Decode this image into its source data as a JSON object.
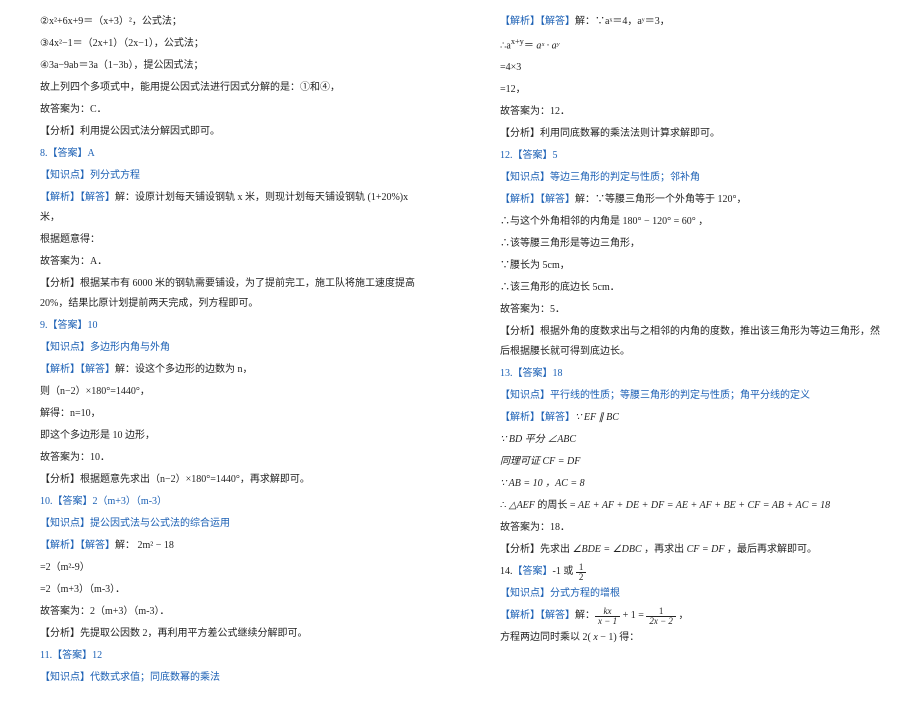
{
  "left": [
    {
      "t": "②x²+6x+9＝（x+3）²，公式法；"
    },
    {
      "t": "③4x²−1＝（2x+1）（2x−1），公式法；"
    },
    {
      "t": "④3a−9ab＝3a（1−3b），提公因式法；"
    },
    {
      "t": "故上列四个多项式中，能用提公因式法进行因式分解的是：①和④，"
    },
    {
      "t": "故答案为：C．"
    },
    {
      "t": "【分析】利用提公因式法分解因式即可。"
    },
    {
      "t": "8.【答案】A",
      "cls": "ans"
    },
    {
      "t": "【知识点】列分式方程",
      "cls": "blue"
    },
    {
      "lead": "【解析】【解答】",
      "leadCls": "blue",
      "rest": "解：设原计划每天铺设钢轨 x 米，则现计划每天铺设钢轨 (1+20%)x 米，"
    },
    {
      "t": "根据题意得："
    },
    {
      "t": "故答案为：A．"
    },
    {
      "t": "【分析】根据某市有 6000 米的钢轨需要铺设，为了提前完工，施工队将施工速度提高 20%，结果比原计划提前两天完成，列方程即可。"
    },
    {
      "t": "9.【答案】10",
      "cls": "ans"
    },
    {
      "t": "【知识点】多边形内角与外角",
      "cls": "blue"
    },
    {
      "lead": "【解析】【解答】",
      "leadCls": "blue",
      "rest": "解：设这个多边形的边数为 n，"
    },
    {
      "t": "则（n−2）×180°=1440°，"
    },
    {
      "t": "解得：n=10，"
    },
    {
      "t": "即这个多边形是 10 边形，"
    },
    {
      "t": "故答案为：10．"
    },
    {
      "t": "【分析】根据题意先求出（n−2）×180°=1440°，再求解即可。"
    },
    {
      "t": "10.【答案】2（m+3）（m-3）",
      "cls": "ans"
    },
    {
      "t": "【知识点】提公因式法与公式法的综合运用",
      "cls": "blue"
    },
    {
      "lead": "【解析】【解答】",
      "leadCls": "blue",
      "rest": "解：  2m² − 18"
    },
    {
      "t": "=2（m²-9）"
    },
    {
      "t": "=2（m+3）（m-3）．"
    },
    {
      "t": "故答案为：2（m+3）（m-3）．"
    },
    {
      "t": "【分析】先提取公因数 2，再利用平方差公式继续分解即可。"
    },
    {
      "t": "11.【答案】12",
      "cls": "ans"
    },
    {
      "t": "【知识点】代数式求值；同底数幂的乘法",
      "cls": "blue"
    }
  ],
  "right": [
    {
      "lead": "【解析】【解答】",
      "leadCls": "blue",
      "rest": "解：∵aˣ＝4，aʸ＝3，"
    },
    {
      "html": "∴a<sup>x+y</sup>＝ <span class='math'>aˣ · aʸ</span>"
    },
    {
      "t": "=4×3"
    },
    {
      "t": "=12，"
    },
    {
      "t": "故答案为：12．"
    },
    {
      "t": "【分析】利用同底数幂的乘法法则计算求解即可。"
    },
    {
      "t": "12.【答案】5",
      "cls": "ans"
    },
    {
      "t": "【知识点】等边三角形的判定与性质；邻补角",
      "cls": "blue"
    },
    {
      "lead": "【解析】【解答】",
      "leadCls": "blue",
      "rest": "解：∵等腰三角形一个外角等于 120°，"
    },
    {
      "t": "∴与这个外角相邻的内角是  180° − 120° = 60° ，"
    },
    {
      "t": "∴该等腰三角形是等边三角形，"
    },
    {
      "t": "∵腰长为 5cm，"
    },
    {
      "t": "∴该三角形的底边长 5cm．"
    },
    {
      "t": "故答案为：5．"
    },
    {
      "t": "【分析】根据外角的度数求出与之相邻的内角的度数，推出该三角形为等边三角形，然后根据腰长就可得到底边长。"
    },
    {
      "t": "13.【答案】18",
      "cls": "ans"
    },
    {
      "t": "【知识点】平行线的性质；等腰三角形的判定与性质；角平分线的定义",
      "cls": "blue"
    },
    {
      "lead": "【解析】【解答】",
      "leadCls": "blue",
      "rest": "∵ EF ∥ BC",
      "restCls": "math"
    },
    {
      "t": "∵ BD  平分 ∠ABC",
      "cls": "math"
    },
    {
      "t": "同理可证 CF = DF",
      "cls": "math"
    },
    {
      "t": "∵ AB = 10 ，AC = 8",
      "cls": "math"
    },
    {
      "html": "∴ <span class='math'>△AEF</span> 的周长 = <span class='math'>AE + AF + DE + DF = AE + AF + BE + CF = AB + AC = 18</span>"
    },
    {
      "t": "故答案为：18．"
    },
    {
      "html": "【分析】先求出 <span class='math'>∠BDE = ∠DBC</span> ，再求出 <span class='math'>CF = DF</span> ，最后再求解即可。"
    },
    {
      "html": "14.<span class='ans'>【答案】</span>-1 或 <span class='frac'><span class='n'>1</span><span class='d'>2</span></span>"
    },
    {
      "t": "【知识点】分式方程的增根",
      "cls": "blue"
    },
    {
      "lead": "【解析】【解答】",
      "leadCls": "blue",
      "html": "解：<span class='frac'><span class='n math'>kx</span><span class='d math'>x − 1</span></span> + 1 = <span class='frac'><span class='n'>1</span><span class='d math'>2x − 2</span></span> ，"
    },
    {
      "html": "方程两边同时乘以 2( <span class='math'>x</span> − 1) 得："
    }
  ]
}
